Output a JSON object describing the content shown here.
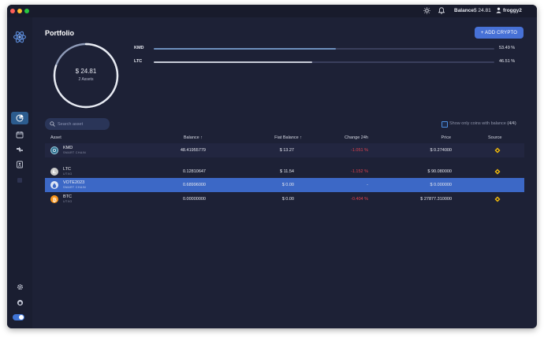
{
  "header": {
    "balance_label": "Balance",
    "balance_value": "$ 24.81",
    "username": "froggy2"
  },
  "page": {
    "title": "Portfolio"
  },
  "add_button": {
    "label": "+ ADD CRYPTO"
  },
  "summary": {
    "total": "$ 24.81",
    "assets": "2 Assets",
    "ring_progress_fraction": 0.8
  },
  "distribution": [
    {
      "ticker": "KMD",
      "percent_text": "53.49 %",
      "percent": 53.49,
      "color": "#6d8fbd"
    },
    {
      "ticker": "LTC",
      "percent_text": "46.51 %",
      "percent": 46.51,
      "color": "#c8ccd8"
    }
  ],
  "search": {
    "placeholder": "Search asset"
  },
  "filter": {
    "label": "Show only coins with balance",
    "count": "(4/4)"
  },
  "table": {
    "headers": {
      "asset": "Asset",
      "balance": "Balance",
      "fiat": "Fiat Balance",
      "change": "Change 24h",
      "price": "Price",
      "source": "Source"
    },
    "rows": [
      {
        "name": "KMD",
        "sub": "SMART CHAIN",
        "balance": "48.41955779",
        "fiat": "$ 13.27",
        "change": "-1.051 %",
        "change_negative": true,
        "price": "$ 0.274000",
        "source": "binance-icon",
        "icon": "kmd-icon",
        "coin_color": "#2e6f8e"
      },
      {
        "name": "LTC",
        "sub": "UTXO",
        "balance": "0.12810647",
        "fiat": "$ 11.54",
        "change": "-1.152 %",
        "change_negative": true,
        "price": "$ 90.080000",
        "source": "binance-icon",
        "icon": "ltc-icon",
        "coin_color": "#c9c9c9"
      },
      {
        "name": "VOTE2023",
        "sub": "SMART CHAIN",
        "balance": "0.68996000",
        "fiat": "$ 0.00",
        "change": "-",
        "change_negative": false,
        "price": "$ 0.000000",
        "source": "",
        "icon": "vote2023-icon",
        "coin_color": "#dfe6f5"
      },
      {
        "name": "BTC",
        "sub": "UTXO",
        "balance": "0.00000000",
        "fiat": "$ 0.00",
        "change": "-0.404 %",
        "change_negative": true,
        "price": "$ 27877.310000",
        "source": "binance-icon",
        "icon": "btc-icon",
        "coin_color": "#f7931a"
      }
    ]
  },
  "colors": {
    "background": "#1d2136",
    "sidebar": "#1a1e31",
    "accent": "#4771d6",
    "selected_row": "#3c68c6",
    "negative": "#e0424e",
    "binance": "#f0b90b"
  }
}
